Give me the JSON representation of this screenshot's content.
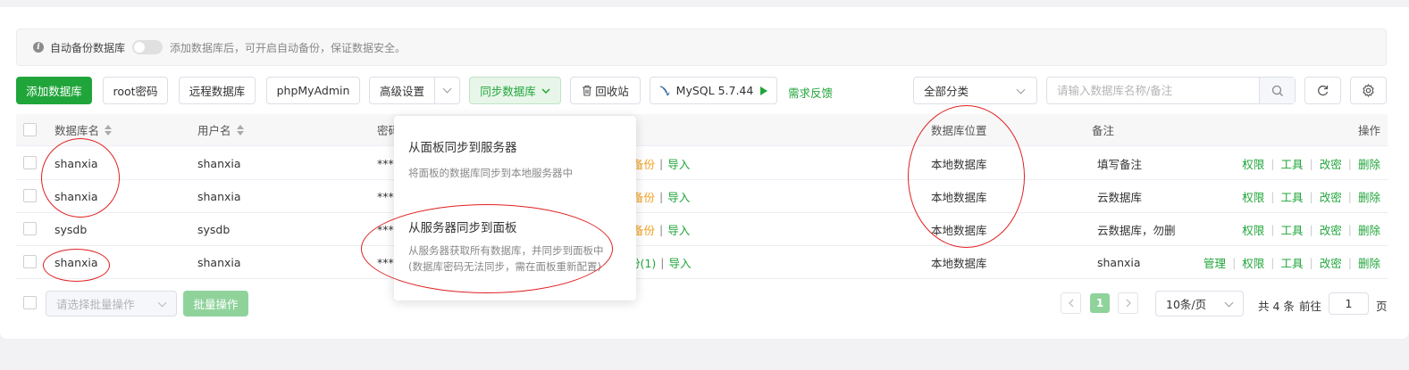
{
  "tip": {
    "label": "自动备份数据库",
    "description": "添加数据库后，可开启自动备份，保证数据安全。"
  },
  "toolbar": {
    "add_db": "添加数据库",
    "root_pwd": "root密码",
    "remote_db": "远程数据库",
    "phpmyadmin": "phpMyAdmin",
    "advanced": "高级设置",
    "sync_db": "同步数据库",
    "recycle": "回收站",
    "mysql_version": "MySQL 5.7.44",
    "feedback": "需求反馈",
    "category": "全部分类",
    "search_placeholder": "请输入数据库名称/备注"
  },
  "table": {
    "headers": {
      "name": "数据库名",
      "user": "用户名",
      "password": "密码",
      "location": "数据库位置",
      "remark": "备注",
      "ops": "操作"
    },
    "rows": [
      {
        "name": "shanxia",
        "user": "shanxia",
        "password": "***",
        "backup": "备份",
        "import": "导入",
        "location": "本地数据库",
        "remark": "填写备注",
        "manage": ""
      },
      {
        "name": "shanxia",
        "user": "shanxia",
        "password": "***",
        "backup": "备份",
        "import": "导入",
        "location": "本地数据库",
        "remark": "云数据库",
        "manage": ""
      },
      {
        "name": "sysdb",
        "user": "sysdb",
        "password": "***",
        "backup": "备份",
        "import": "导入",
        "location": "本地数据库",
        "remark": "云数据库，勿删",
        "manage": ""
      },
      {
        "name": "shanxia",
        "user": "shanxia",
        "password": "***",
        "backup": "份(1)",
        "import": "导入",
        "location": "本地数据库",
        "remark": "shanxia",
        "manage": "管理"
      }
    ],
    "op_labels": {
      "perm": "权限",
      "tools": "工具",
      "change_pwd": "改密",
      "delete": "删除"
    }
  },
  "dropdown": {
    "item1_title": "从面板同步到服务器",
    "item1_desc": "将面板的数据库同步到本地服务器中",
    "item2_title": "从服务器同步到面板",
    "item2_desc_line1": "从服务器获取所有数据库，并同步到面板中",
    "item2_desc_line2": "(数据库密码无法同步，需在面板重新配置)"
  },
  "footer": {
    "batch_placeholder": "请选择批量操作",
    "batch_button": "批量操作",
    "current_page": "1",
    "page_size": "10条/页",
    "total": "共 4 条",
    "goto_label": "前往",
    "goto_value": "1",
    "page_suffix": "页"
  },
  "colors": {
    "accent": "#20a53a",
    "annotation": "#e02020",
    "backup_link": "#f0a020"
  }
}
